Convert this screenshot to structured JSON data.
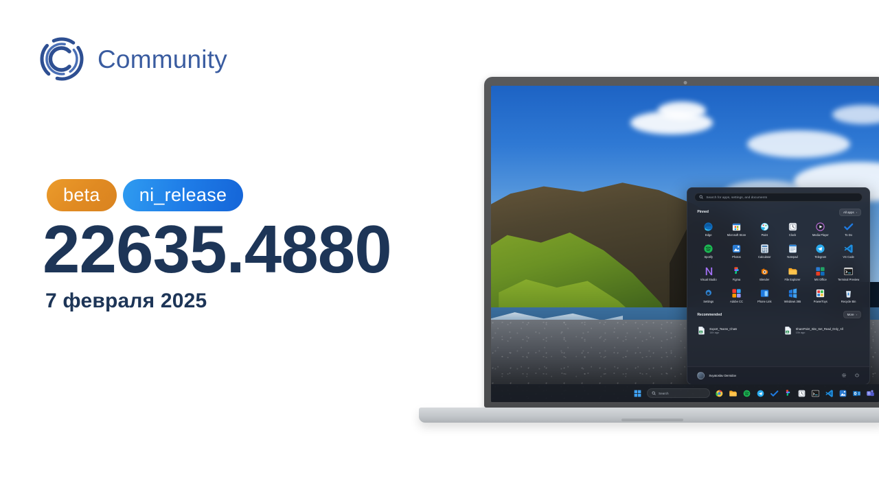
{
  "brand": {
    "name": "Community",
    "logo_icon": "community-c-logo",
    "color": "#3a5ca0"
  },
  "release": {
    "badges": [
      {
        "label": "beta",
        "color": "#e08a22"
      },
      {
        "label": "ni_release",
        "color": "#1f7ee8"
      }
    ],
    "build_number": "22635.4880",
    "date": "7 февраля 2025",
    "text_color": "#1d3557"
  },
  "device": {
    "type": "laptop",
    "camera_icon": "webcam-dot"
  },
  "start_menu": {
    "search": {
      "placeholder": "Search for apps, settings, and documents",
      "icon": "search-icon"
    },
    "pinned": {
      "title": "Pinned",
      "all_apps_label": "All apps",
      "all_apps_chevron": "chevron-right-icon",
      "apps": [
        {
          "label": "Edge",
          "icon": "edge-icon"
        },
        {
          "label": "Microsoft Store",
          "icon": "microsoft-store-icon"
        },
        {
          "label": "Paint",
          "icon": "paint-icon"
        },
        {
          "label": "Clock",
          "icon": "clock-icon"
        },
        {
          "label": "Media Player",
          "icon": "media-player-icon"
        },
        {
          "label": "To Do",
          "icon": "to-do-icon"
        },
        {
          "label": "Spotify",
          "icon": "spotify-icon"
        },
        {
          "label": "Photos",
          "icon": "photos-icon"
        },
        {
          "label": "Calculator",
          "icon": "calculator-icon"
        },
        {
          "label": "Notepad",
          "icon": "notepad-icon"
        },
        {
          "label": "Telegram",
          "icon": "telegram-icon"
        },
        {
          "label": "VS Code",
          "icon": "vs-code-icon"
        },
        {
          "label": "Visual Studio",
          "icon": "visual-studio-icon"
        },
        {
          "label": "Figma",
          "icon": "figma-icon"
        },
        {
          "label": "Blender",
          "icon": "blender-icon"
        },
        {
          "label": "File Explorer",
          "icon": "file-explorer-icon"
        },
        {
          "label": "MS Office",
          "icon": "ms-office-icon"
        },
        {
          "label": "Terminal Preview",
          "icon": "terminal-preview-icon"
        },
        {
          "label": "Settings",
          "icon": "settings-gear-icon"
        },
        {
          "label": "Adobe CC",
          "icon": "adobe-cc-icon"
        },
        {
          "label": "Phone Link",
          "icon": "phone-link-icon"
        },
        {
          "label": "Windows 365",
          "icon": "windows-365-icon"
        },
        {
          "label": "PowerToys",
          "icon": "powertoys-icon"
        },
        {
          "label": "Recycle Bin",
          "icon": "recycle-bin-icon"
        }
      ]
    },
    "recommended": {
      "title": "Recommended",
      "more_label": "More",
      "more_chevron": "chevron-right-icon",
      "items": [
        {
          "name": "Export_Teams_Chats",
          "meta": "14h ago",
          "icon": "excel-document-icon"
        },
        {
          "name": "SharePoint_Site_Set_Read_Only_All",
          "meta": "15h ago",
          "icon": "excel-document-icon"
        }
      ]
    },
    "account": {
      "user_name": "Svyatoslav Demidov",
      "avatar_icon": "user-avatar",
      "settings_icon": "gear-icon",
      "power_icon": "power-icon"
    }
  },
  "taskbar": {
    "start_icon": "windows-start-icon",
    "search": {
      "label": "Search",
      "icon": "search-icon"
    },
    "items": [
      {
        "icon": "chrome-icon"
      },
      {
        "icon": "file-explorer-icon"
      },
      {
        "icon": "spotify-icon"
      },
      {
        "icon": "telegram-icon"
      },
      {
        "icon": "to-do-icon"
      },
      {
        "icon": "figma-icon"
      },
      {
        "icon": "clock-icon"
      },
      {
        "icon": "terminal-icon"
      },
      {
        "icon": "vs-code-icon"
      },
      {
        "icon": "photos-icon"
      },
      {
        "icon": "outlook-icon"
      },
      {
        "icon": "teams-icon"
      }
    ]
  }
}
